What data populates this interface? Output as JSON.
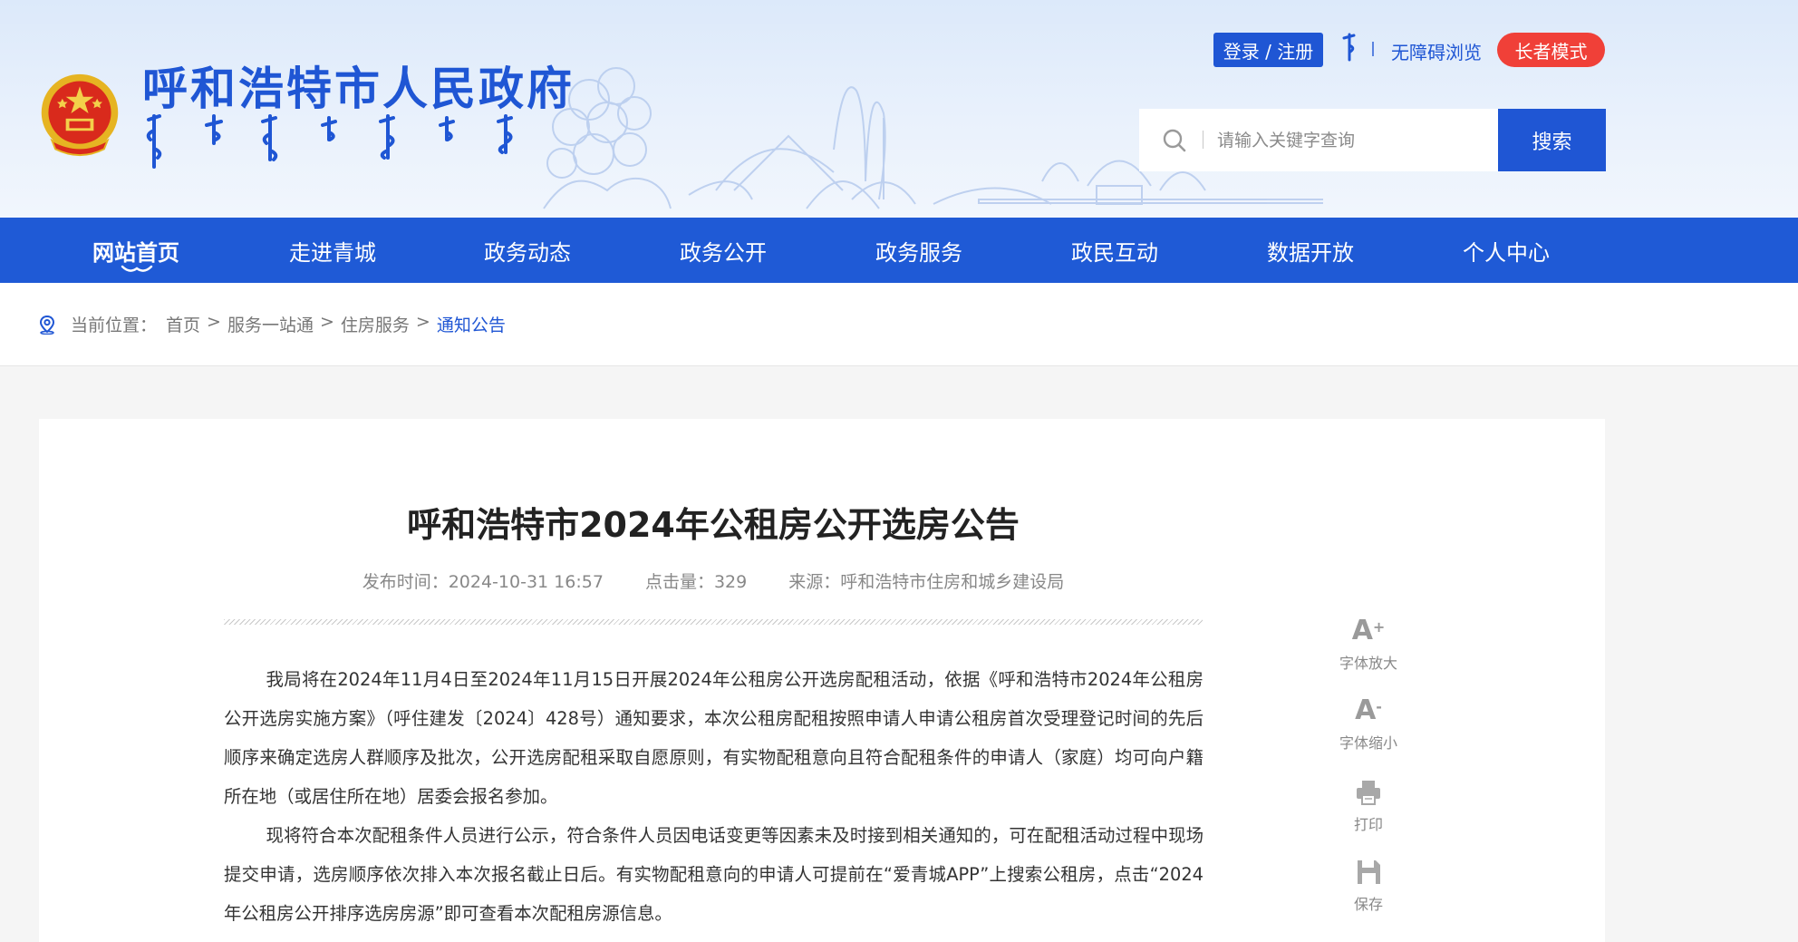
{
  "header": {
    "site_title": "呼和浩特市人民政府",
    "login_label": "登录 / 注册",
    "accessible_label": "无障碍浏览",
    "elder_mode_label": "长者模式",
    "search": {
      "placeholder": "请输入关键字查询",
      "button_label": "搜索"
    },
    "colors": {
      "brand_blue": "#1f56d4",
      "elder_red": "#f04038"
    }
  },
  "nav": {
    "items": [
      {
        "label": "网站首页",
        "active": true
      },
      {
        "label": "走进青城"
      },
      {
        "label": "政务动态"
      },
      {
        "label": "政务公开"
      },
      {
        "label": "政务服务"
      },
      {
        "label": "政民互动"
      },
      {
        "label": "数据开放"
      },
      {
        "label": "个人中心"
      }
    ]
  },
  "breadcrumb": {
    "prefix": "当前位置：",
    "items": [
      "首页",
      "服务一站通",
      "住房服务",
      "通知公告"
    ],
    "separator": ">"
  },
  "article": {
    "title": "呼和浩特市2024年公租房公开选房公告",
    "publish_time": "发布时间：2024-10-31 16:57",
    "clicks": "点击量：329",
    "source": "来源：呼和浩特市住房和城乡建设局",
    "paragraphs": [
      "我局将在2024年11月4日至2024年11月15日开展2024年公租房公开选房配租活动，依据《呼和浩特市2024年公租房公开选房实施方案》（呼住建发〔2024〕428号）通知要求，本次公租房配租按照申请人申请公租房首次受理登记时间的先后顺序来确定选房人群顺序及批次，公开选房配租采取自愿原则，有实物配租意向且符合配租条件的申请人（家庭）均可向户籍所在地（或居住所在地）居委会报名参加。",
      "现将符合本次配租条件人员进行公示，符合条件人员因电话变更等因素未及时接到相关通知的，可在配租活动过程中现场提交申请，选房顺序依次排入本次报名截止日后。有实物配租意向的申请人可提前在“爱青城APP”上搜索公租房，点击“2024年公租房公开排序选房房源”即可查看本次配租房源信息。"
    ]
  },
  "tools": {
    "font_larger": "字体放大",
    "font_smaller": "字体缩小",
    "print": "打印",
    "save": "保存"
  }
}
